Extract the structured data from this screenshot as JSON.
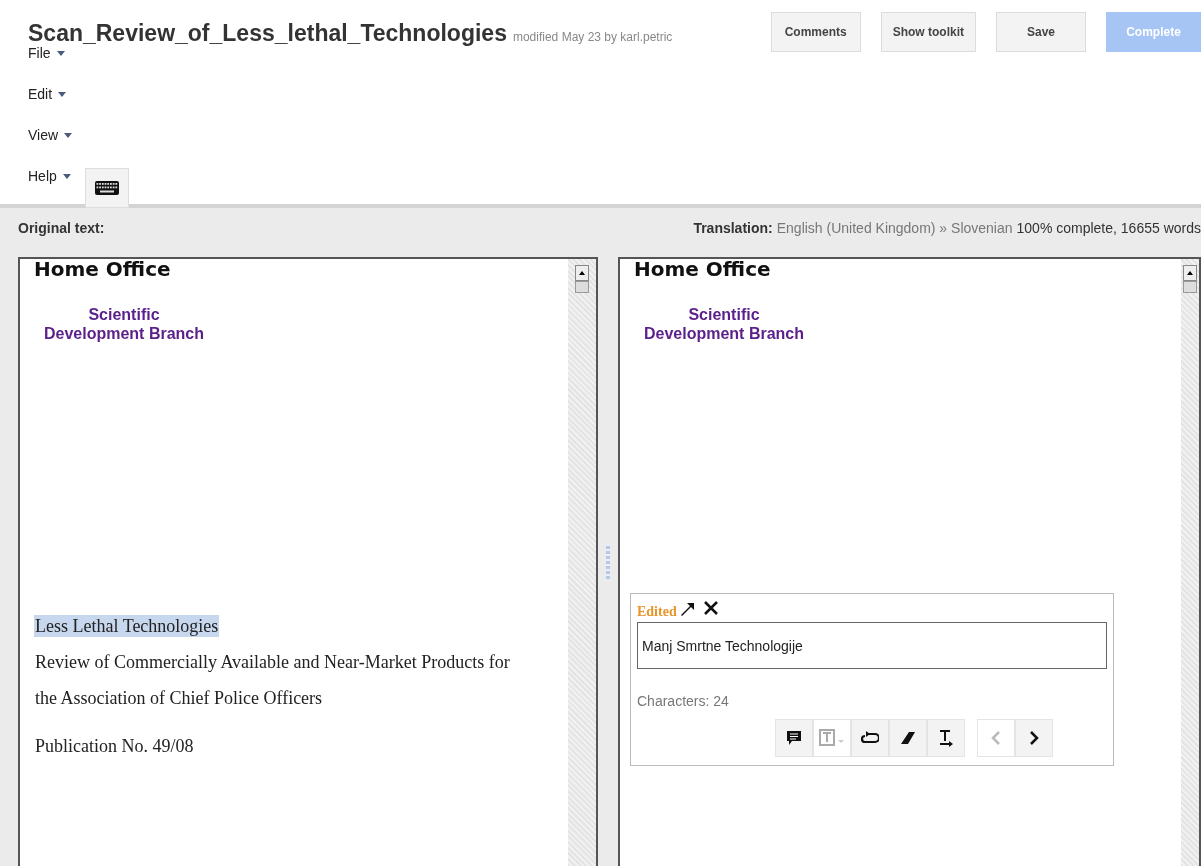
{
  "document": {
    "title": "Scan_Review_of_Less_lethal_Technologies",
    "modified": "modified May 23 by karl.petric"
  },
  "header_buttons": [
    {
      "label": "Comments",
      "kind": "normal"
    },
    {
      "label": "Show toolkit",
      "kind": "normal"
    },
    {
      "label": "Save",
      "kind": "normal"
    },
    {
      "label": "Complete",
      "kind": "primary"
    }
  ],
  "menu": [
    "File",
    "Edit",
    "View",
    "Help"
  ],
  "original": {
    "label": "Original text:",
    "heading": "Home Office",
    "logo_lines": [
      "Scientific",
      "Development Branch"
    ],
    "segments": [
      {
        "text": "Less Lethal Technologies",
        "selected": true
      },
      {
        "text": "Review of Commercially Available and Near-Market Products for",
        "selected": false
      },
      {
        "text": "the Association of Chief Police Officers",
        "selected": false
      },
      {
        "text": "Publication No. 49/08",
        "selected": false
      }
    ]
  },
  "translation": {
    "label": "Translation:",
    "languages": "English (United Kingdom) » Slovenian",
    "progress": "100% complete,  16655 words",
    "heading": "Home Office",
    "logo_lines": [
      "Scientific",
      "Development Branch"
    ]
  },
  "editor": {
    "status": "Edited",
    "value": "Manj Smrtne Technologije",
    "characters": "Characters: 24",
    "tools": [
      {
        "kind": "comment",
        "disabled": false
      },
      {
        "kind": "format",
        "disabled": true
      },
      {
        "kind": "loop",
        "disabled": false
      },
      {
        "kind": "eraser",
        "disabled": false
      },
      {
        "kind": "text-arrow",
        "disabled": false
      },
      {
        "kind": "prev",
        "disabled": true
      },
      {
        "kind": "next",
        "disabled": false
      }
    ]
  }
}
